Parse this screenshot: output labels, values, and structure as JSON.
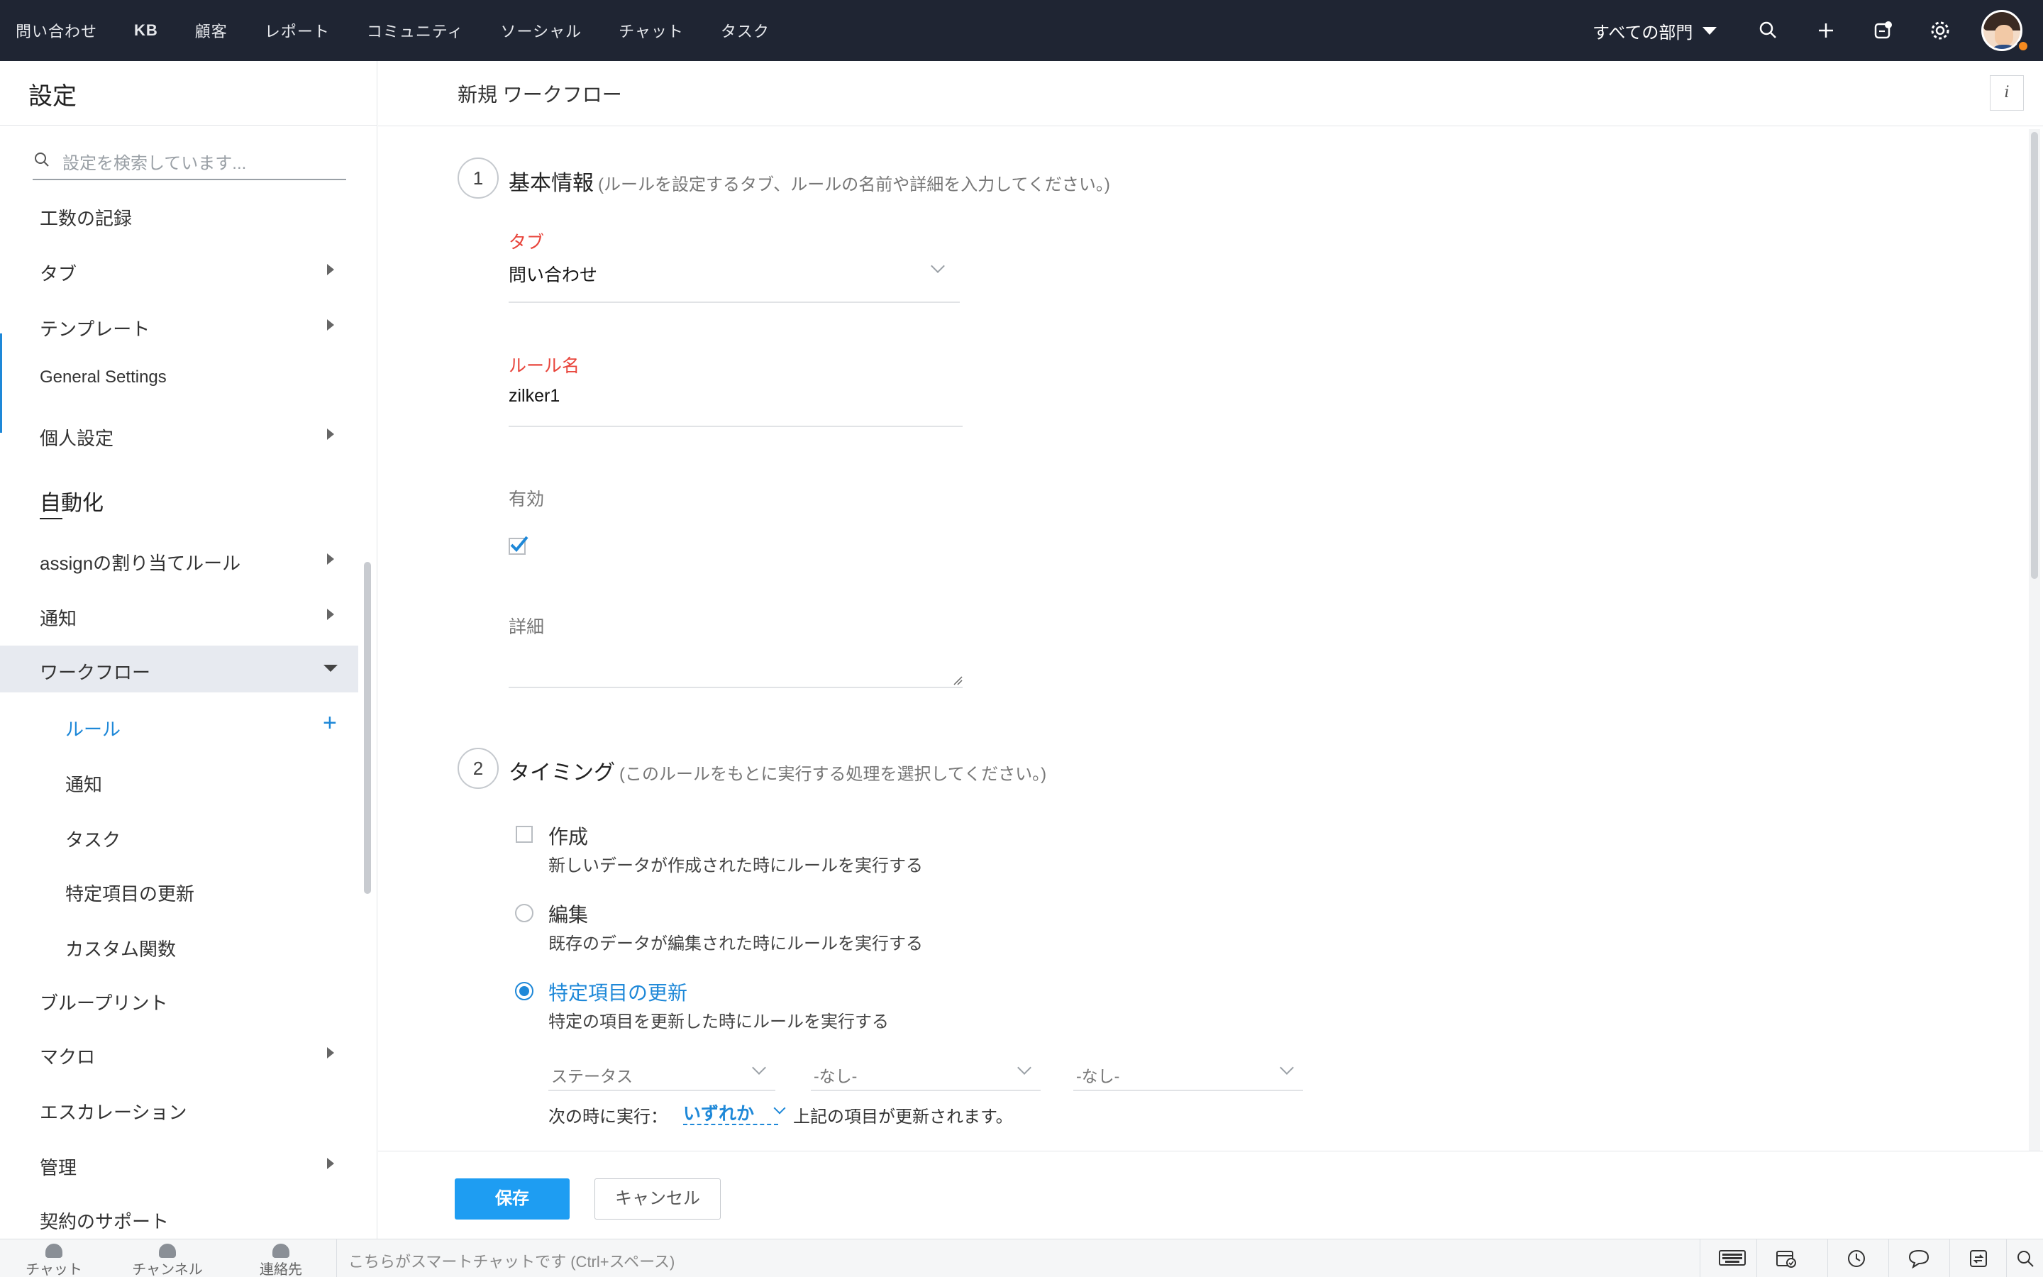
{
  "topbar": {
    "nav": [
      "問い合わせ",
      "KB",
      "顧客",
      "レポート",
      "コミュニティ",
      "ソーシャル",
      "チャット",
      "タスク"
    ],
    "department": "すべての部門",
    "icons": [
      "search-icon",
      "plus-icon",
      "notification-icon",
      "gear-icon"
    ],
    "avatar_status_color": "#f58a1f"
  },
  "sidebar": {
    "title": "設定",
    "search_placeholder": "設定を検索しています...",
    "items_top": [
      {
        "label": "工数の記録",
        "arrow": false
      },
      {
        "label": "タブ",
        "arrow": true
      },
      {
        "label": "テンプレート",
        "arrow": true
      },
      {
        "label": "General Settings",
        "arrow": false
      },
      {
        "label": "個人設定",
        "arrow": true
      }
    ],
    "section": "自動化",
    "items_auto": [
      {
        "label": "assignの割り当てルール",
        "arrow": true
      },
      {
        "label": "通知",
        "arrow": true
      },
      {
        "label": "ワークフロー",
        "expanded": true
      }
    ],
    "workflow_sub": [
      "ルール",
      "通知",
      "タスク",
      "特定項目の更新",
      "カスタム関数"
    ],
    "items_bottom": [
      {
        "label": "ブループリント",
        "arrow": false
      },
      {
        "label": "マクロ",
        "arrow": true
      },
      {
        "label": "エスカレーション",
        "arrow": false
      },
      {
        "label": "管理",
        "arrow": true
      },
      {
        "label": "契約のサポート",
        "arrow": false
      }
    ]
  },
  "main": {
    "title": "新規 ワークフロー",
    "info_label": "i",
    "step1": {
      "num": "1",
      "title": "基本情報",
      "hint": "(ルールを設定するタブ、ルールの名前や詳細を入力してください。)",
      "tab_label": "タブ",
      "tab_value": "問い合わせ",
      "rule_name_label": "ルール名",
      "rule_name_value": "zilker1",
      "active_label": "有効",
      "active_checked": true,
      "detail_label": "詳細",
      "detail_value": ""
    },
    "step2": {
      "num": "2",
      "title": "タイミング",
      "hint": "(このルールをもとに実行する処理を選択してください。)",
      "options": [
        {
          "title": "作成",
          "desc": "新しいデータが作成された時にルールを実行する",
          "selected": false
        },
        {
          "title": "編集",
          "desc": "既存のデータが編集された時にルールを実行する",
          "selected": false
        },
        {
          "title": "特定項目の更新",
          "desc": "特定の項目を更新した時にルールを実行する",
          "selected": true
        }
      ],
      "field_selects": [
        "ステータス",
        "-なし-",
        "-なし-"
      ],
      "run_label": "次の時に実行：",
      "run_value": "いずれか",
      "run_after": "上記の項目が更新されます。"
    },
    "buttons": {
      "save": "保存",
      "cancel": "キャンセル"
    }
  },
  "bottombar": {
    "items": [
      "チャット",
      "チャンネル",
      "連絡先"
    ],
    "chat_placeholder": "こちらがスマートチャットです (Ctrl+スペース)",
    "icons": [
      "keyboard-icon",
      "calendar-check-icon",
      "clock-icon",
      "chat-bubbles-icon",
      "share-icon",
      "search-icon"
    ]
  },
  "colors": {
    "accent": "#1e88d8",
    "topbar": "#1f2533",
    "required": "#e8453c",
    "save_button": "#1e9df2"
  }
}
